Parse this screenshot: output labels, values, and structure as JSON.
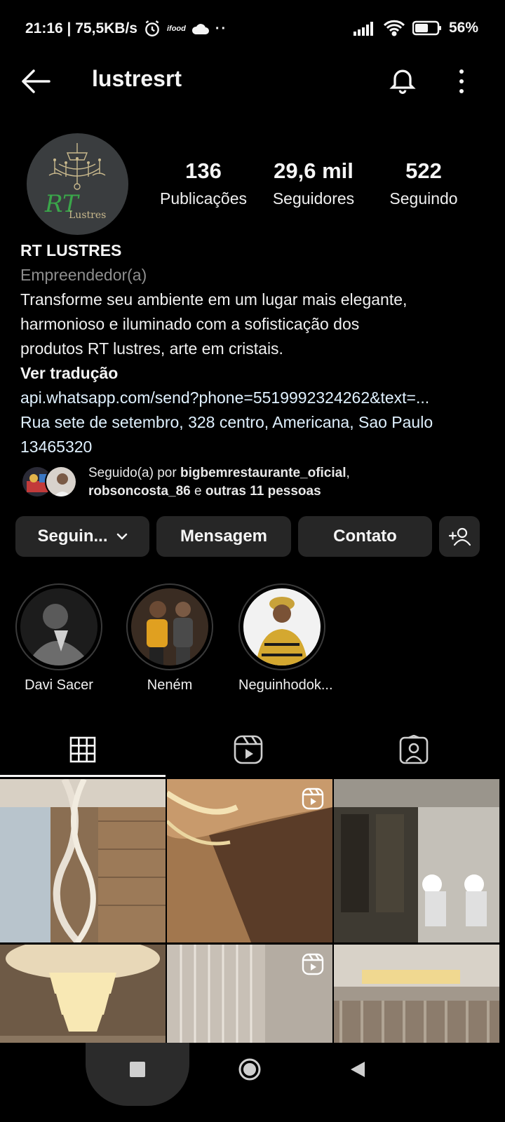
{
  "status_bar": {
    "left_text": "21:16 | 75,5KB/s",
    "ifood": "ifood",
    "dots": "··",
    "battery": "56%"
  },
  "header": {
    "username": "lustresrt"
  },
  "profile": {
    "avatar_brand": "Lustres",
    "avatar_monogram": "RT",
    "stats": [
      {
        "value": "136",
        "label": "Publicações"
      },
      {
        "value": "29,6 mil",
        "label": "Seguidores"
      },
      {
        "value": "522",
        "label": "Seguindo"
      }
    ],
    "name": "RT LUSTRES",
    "category": "Empreendedor(a)",
    "bio_lines": [
      "Transforme seu ambiente em um lugar mais elegante,",
      "harmonioso e iluminado com a sofisticação dos",
      "produtos RT lustres, arte em cristais."
    ],
    "translate": "Ver tradução",
    "link": "api.whatsapp.com/send?phone=5519992324262&text=...",
    "address_lines": [
      "Rua sete de setembro, 328 centro, Americana, Sao Paulo",
      "13465320"
    ],
    "followed_by": {
      "prefix": "Seguido(a) por",
      "user1": "bigbemrestaurante_oficial",
      "comma": ",",
      "user2": "robsoncosta_86",
      "and": "e",
      "others": "outras 11 pessoas"
    }
  },
  "actions": {
    "follow": "Seguin...",
    "message": "Mensagem",
    "contact": "Contato"
  },
  "highlights": [
    {
      "label": "Davi Sacer"
    },
    {
      "label": "Neném"
    },
    {
      "label": "Neguinhodok..."
    }
  ],
  "tabs": [
    "grid-icon",
    "reels-icon",
    "tagged-icon"
  ],
  "grid": [
    {
      "type": "photo"
    },
    {
      "type": "reel"
    },
    {
      "type": "photo"
    },
    {
      "type": "photo"
    },
    {
      "type": "reel"
    },
    {
      "type": "photo"
    }
  ],
  "colors": {
    "background": "#000000",
    "button": "#262626",
    "secondary_text": "#8e8e8e",
    "link": "#e0f1ff"
  }
}
